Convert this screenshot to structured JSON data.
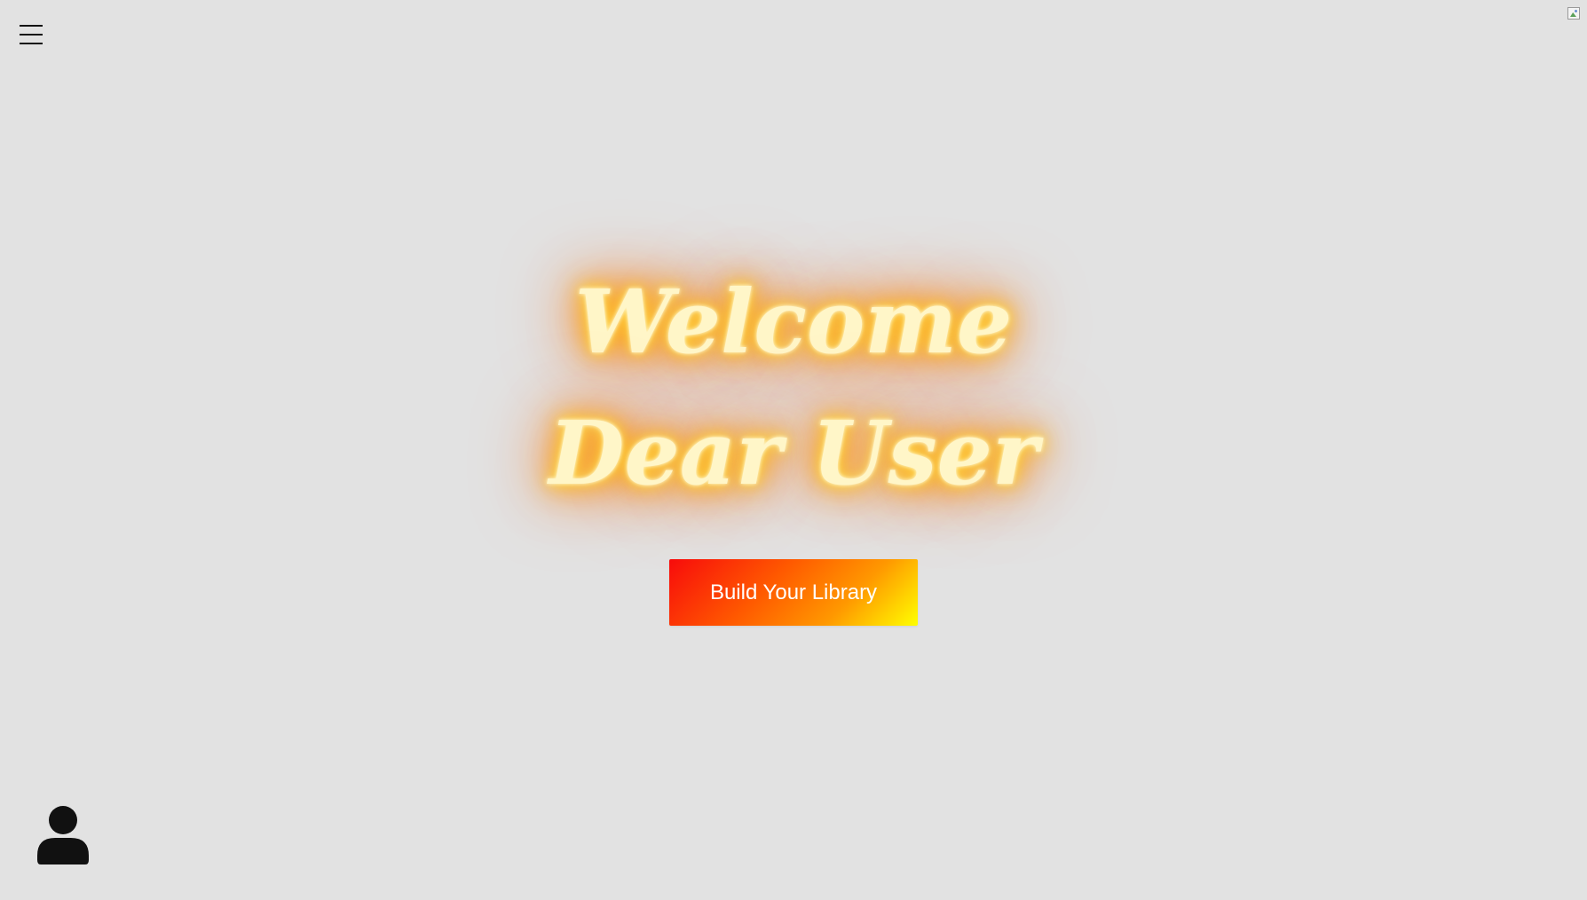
{
  "header": {
    "menu_icon": "hamburger-menu-icon",
    "broken_image_icon": "broken-image-icon"
  },
  "hero": {
    "title": "Welcome Dear User",
    "glow_colors": [
      "#fff6c8",
      "#ffcc22",
      "#ff7a00"
    ]
  },
  "cta": {
    "label": "Build Your Library",
    "gradient": [
      "#f80b0b",
      "#ff9800",
      "#ffff00"
    ],
    "text_color": "#ffffff"
  },
  "footer": {
    "profile_icon": "user-profile-icon"
  },
  "colors": {
    "background": "#e2e2e2",
    "icon": "#111111"
  }
}
